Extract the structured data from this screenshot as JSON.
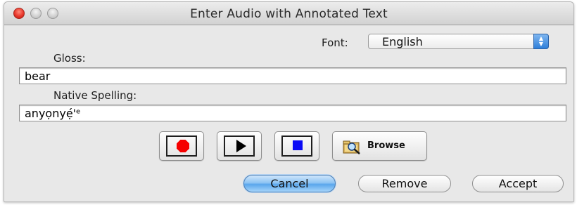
{
  "window": {
    "title": "Enter Audio with Annotated Text"
  },
  "font": {
    "label": "Font:",
    "selected": "English"
  },
  "gloss": {
    "label": "Gloss:",
    "value": "bear"
  },
  "native": {
    "label": "Native Spelling:",
    "value": "anyọnyẹ́'ᵉ"
  },
  "media": {
    "record_icon": "record-icon",
    "play_icon": "play-icon",
    "stop_icon": "stop-icon",
    "browse_icon": "folder-magnifier-icon",
    "browse_label": "Browse"
  },
  "actions": {
    "cancel_label": "Cancel",
    "remove_label": "Remove",
    "accept_label": "Accept"
  },
  "colors": {
    "record": "#f60000",
    "stop": "#0a0af5",
    "default_button": "#5aa6ec"
  }
}
